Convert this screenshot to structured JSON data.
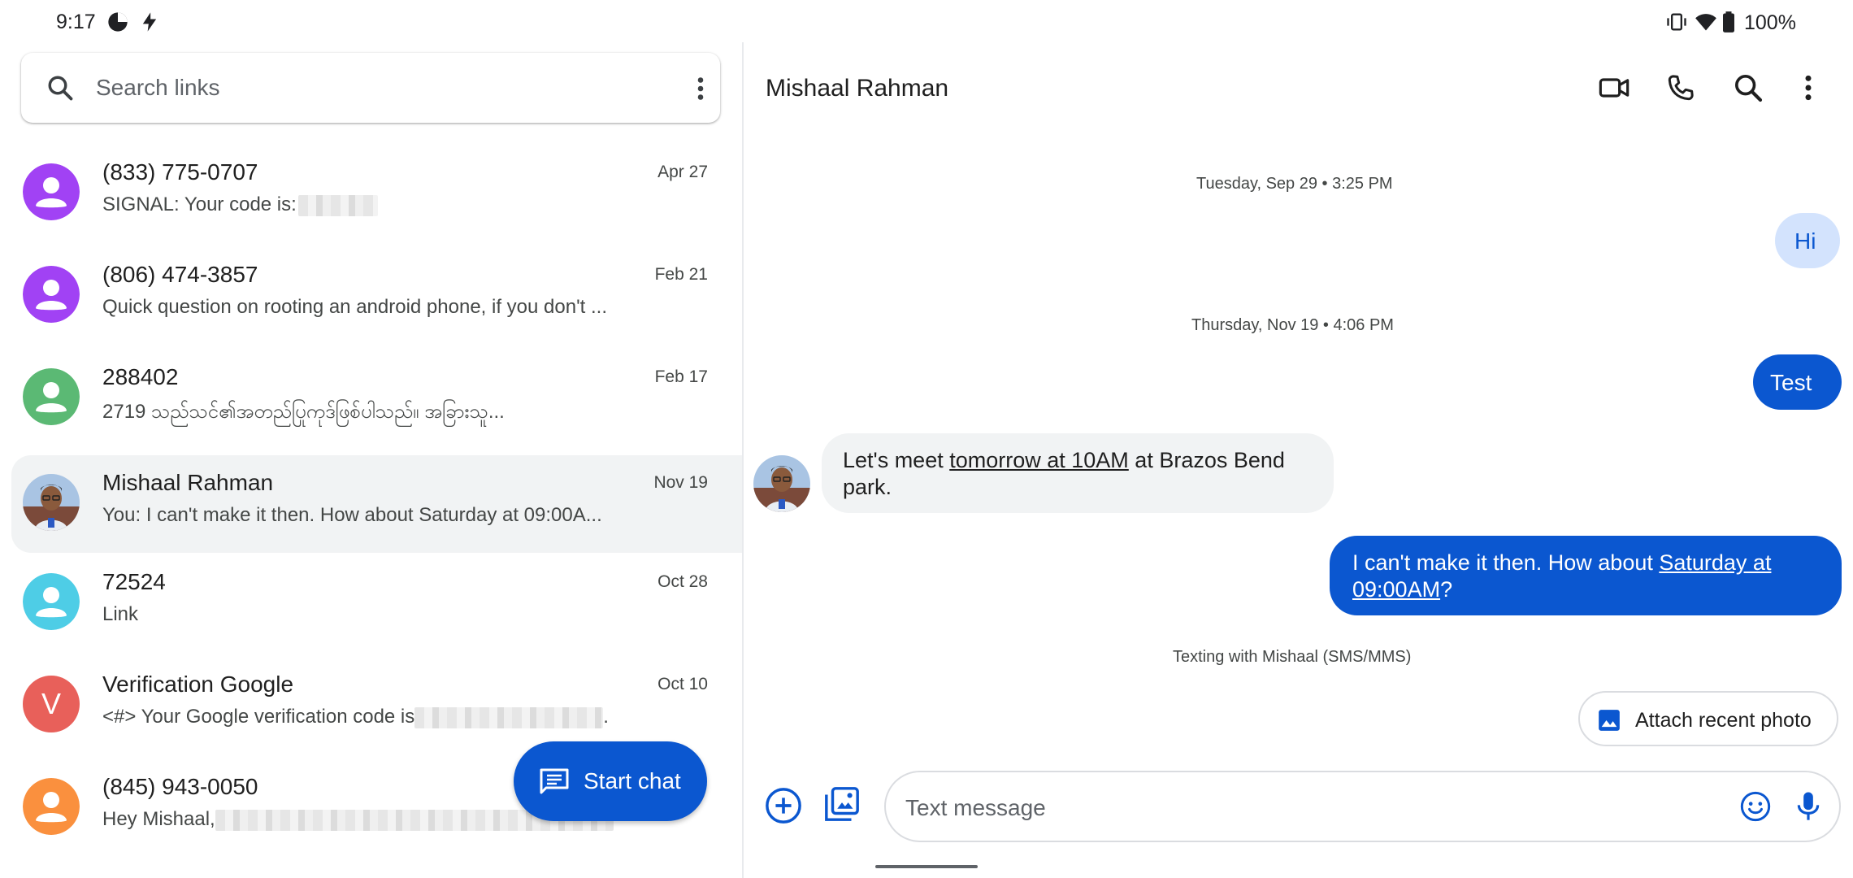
{
  "status_bar": {
    "time": "9:17",
    "battery": "100%"
  },
  "search": {
    "placeholder": "Search links"
  },
  "conversations": [
    {
      "name": "(833) 775-0707",
      "preview": "SIGNAL: Your code is:",
      "date": "Apr 27",
      "avatar_color": "#a142f4"
    },
    {
      "name": "(806) 474-3857",
      "preview": "Quick question on rooting an android phone, if you don't ...",
      "date": "Feb 21",
      "avatar_color": "#a142f4"
    },
    {
      "name": "288402",
      "preview": "2719 သည်သင်၏အတည်ပြုကုဒ်ဖြစ်ပါသည်။ အခြားသူ...",
      "date": "Feb 17",
      "avatar_color": "#5bb974"
    },
    {
      "name": "Mishaal Rahman",
      "preview": "You: I can't make it then. How about Saturday at 09:00A...",
      "date": "Nov 19",
      "avatar_color": "#7aa7d8"
    },
    {
      "name": "72524",
      "preview": "Link",
      "date": "Oct 28",
      "avatar_color": "#4ecde6"
    },
    {
      "name": "Verification Google",
      "preview": "<#> Your Google verification code is",
      "preview_suffix": ".",
      "date": "Oct 10",
      "avatar_color": "#e8605a",
      "avatar_letter": "V"
    },
    {
      "name": "(845) 943-0050",
      "preview": "Hey Mishaal,",
      "date": "",
      "avatar_color": "#fa903e"
    }
  ],
  "fab": {
    "label": "Start chat"
  },
  "chat": {
    "title": "Mishaal Rahman",
    "timestamp_1": "Tuesday, Sep 29 • 3:25 PM",
    "msg_hi": "Hi",
    "timestamp_2": "Thursday, Nov 19 • 4:06 PM",
    "msg_test": "Test",
    "msg_in_a": "Let's meet ",
    "msg_in_link": "tomorrow at 10AM",
    "msg_in_b": " at Brazos Bend park.",
    "msg_out_a": "I can't make it then. How about ",
    "msg_out_link": "Saturday at 09:00AM",
    "msg_out_b": "?",
    "texting_with": "Texting with Mishaal (SMS/MMS)",
    "attach_label": "Attach recent photo",
    "compose_placeholder": "Text message"
  },
  "colors": {
    "accent": "#0b57d0",
    "light_bubble": "#d3e3fd",
    "selected_row": "#f1f3f4"
  }
}
